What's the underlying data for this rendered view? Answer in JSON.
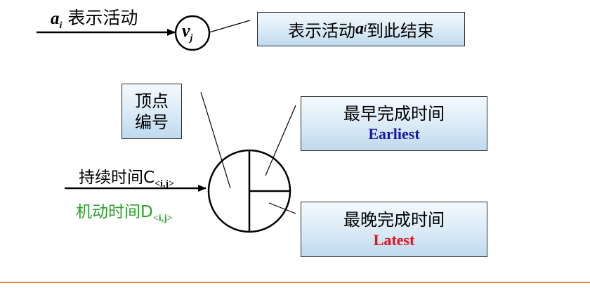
{
  "top_row": {
    "activity_var": "a",
    "activity_sub": "i",
    "activity_text": "表示活动",
    "vertex_var": "v",
    "vertex_sub": "j",
    "end_box": {
      "prefix": "表示活动",
      "var": "a",
      "var_sub": "i",
      "suffix": "到此结束"
    }
  },
  "vertex_number_box": {
    "line1": "顶点",
    "line2": "编号"
  },
  "earliest_box": {
    "line1": "最早完成时间",
    "line2": "Earliest",
    "line2_color": "#1a1aa6"
  },
  "latest_box": {
    "line1": "最晚完成时间",
    "line2": "Latest",
    "line2_color": "#e0141e"
  },
  "duration_label": {
    "text": "持续时间C",
    "sub": "<i,j>",
    "color": "#000000"
  },
  "slack_label": {
    "text": "机动时间D",
    "sub": "<i,j>",
    "color": "#2e9e2e"
  },
  "colors": {
    "footer_line": "#e08a4a",
    "box_border": "#2a2a2a",
    "box_fill_top": "#f3f9fd",
    "box_fill_bottom": "#bfd9ee"
  }
}
